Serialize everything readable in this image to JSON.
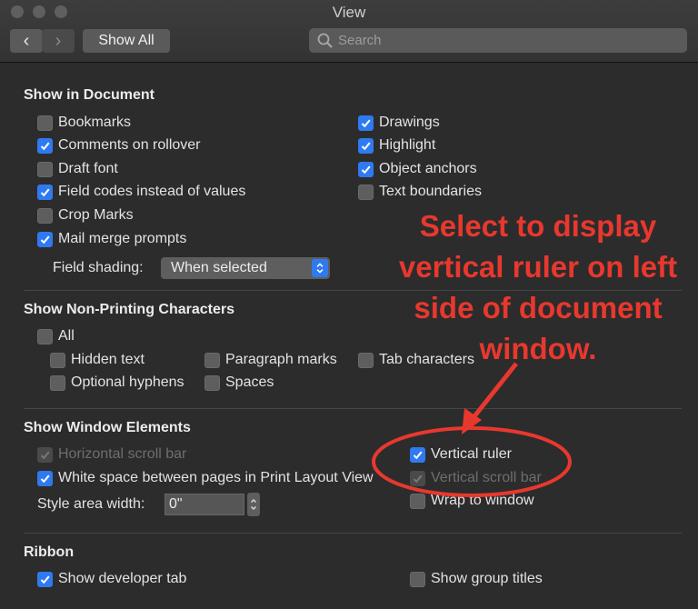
{
  "window": {
    "title": "View"
  },
  "toolbar": {
    "back_label": "‹",
    "forward_label": "›",
    "show_all_label": "Show All",
    "search_placeholder": "Search"
  },
  "show_in_document": {
    "title": "Show in Document",
    "left": [
      {
        "label": "Bookmarks",
        "checked": false
      },
      {
        "label": "Comments on rollover",
        "checked": true
      },
      {
        "label": "Draft font",
        "checked": false
      },
      {
        "label": "Field codes instead of values",
        "checked": true
      },
      {
        "label": "Crop Marks",
        "checked": false
      },
      {
        "label": "Mail merge prompts",
        "checked": true
      }
    ],
    "right": [
      {
        "label": "Drawings",
        "checked": true
      },
      {
        "label": "Highlight",
        "checked": true
      },
      {
        "label": "Object anchors",
        "checked": true
      },
      {
        "label": "Text boundaries",
        "checked": false
      }
    ],
    "field_shading_label": "Field shading:",
    "field_shading_value": "When selected"
  },
  "non_printing": {
    "title": "Show Non-Printing Characters",
    "all": {
      "label": "All",
      "checked": false
    },
    "items": [
      {
        "label": "Hidden text",
        "checked": false
      },
      {
        "label": "Paragraph marks",
        "checked": false
      },
      {
        "label": "Tab characters",
        "checked": false
      },
      {
        "label": "Optional hyphens",
        "checked": false
      },
      {
        "label": "Spaces",
        "checked": false
      }
    ]
  },
  "window_elements": {
    "title": "Show Window Elements",
    "horizontal_scroll": {
      "label": "Horizontal scroll bar",
      "checked": true,
      "enabled": false
    },
    "white_space": {
      "label": "White space between pages in Print Layout View",
      "checked": true
    },
    "style_area_label": "Style area width:",
    "style_area_value": "0\"",
    "vertical_ruler": {
      "label": "Vertical ruler",
      "checked": true
    },
    "vertical_scroll": {
      "label": "Vertical scroll bar",
      "checked": true,
      "enabled": false
    },
    "wrap_to_window": {
      "label": "Wrap to window",
      "checked": false
    }
  },
  "ribbon": {
    "title": "Ribbon",
    "developer_tab": {
      "label": "Show developer tab",
      "checked": true
    },
    "group_titles": {
      "label": "Show group titles",
      "checked": false
    }
  },
  "annotation": {
    "text": "Select to display vertical ruler on left side of document window.",
    "color": "#e8382e"
  },
  "colors": {
    "background": "#2c2c2c",
    "accent": "#2f7af0",
    "annotation": "#e8382e"
  }
}
